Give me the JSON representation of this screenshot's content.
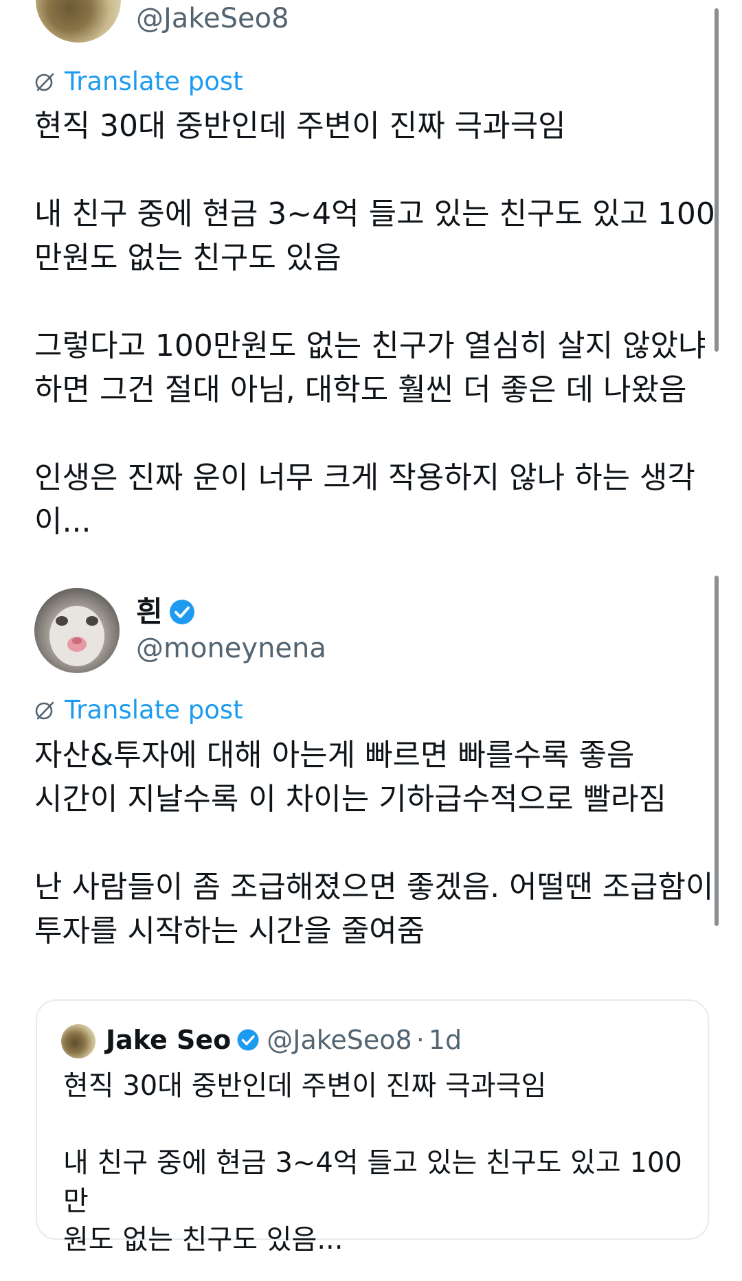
{
  "post1": {
    "handle": "@JakeSeo8",
    "translate_label": "Translate post",
    "body": "현직 30대 중반인데 주변이 진짜 극과극임\n\n내 친구 중에 현금 3~4억 들고 있는 친구도 있고 100\n만원도 없는 친구도 있음\n\n그렇다고 100만원도 없는 친구가 열심히 살지 않았냐\n하면 그건 절대 아님, 대학도 훨씬 더 좋은 데 나왔음\n\n인생은 진짜 운이 너무 크게 작용하지 않나 하는 생각\n이..."
  },
  "post2": {
    "name": "흰",
    "handle": "@moneynena",
    "translate_label": "Translate post",
    "body": "자산&투자에 대해 아는게 빠르면 빠를수록 좋음\n시간이 지날수록 이 차이는 기하급수적으로 빨라짐\n\n난 사람들이 좀 조급해졌으면 좋겠음. 어떨땐 조급함이\n투자를 시작하는 시간을 줄여줌"
  },
  "quote": {
    "name": "Jake Seo",
    "handle": "@JakeSeo8",
    "separator": "·",
    "time": "1d",
    "body": "현직 30대 중반인데 주변이 진짜 극과극임\n\n내 친구 중에 현금 3~4억 들고 있는 친구도 있고 100만\n원도 없는 친구도 있음..."
  },
  "colors": {
    "link_blue": "#1d9bf0",
    "secondary_text": "#536471",
    "verified_blue": "#1d9bf0"
  }
}
